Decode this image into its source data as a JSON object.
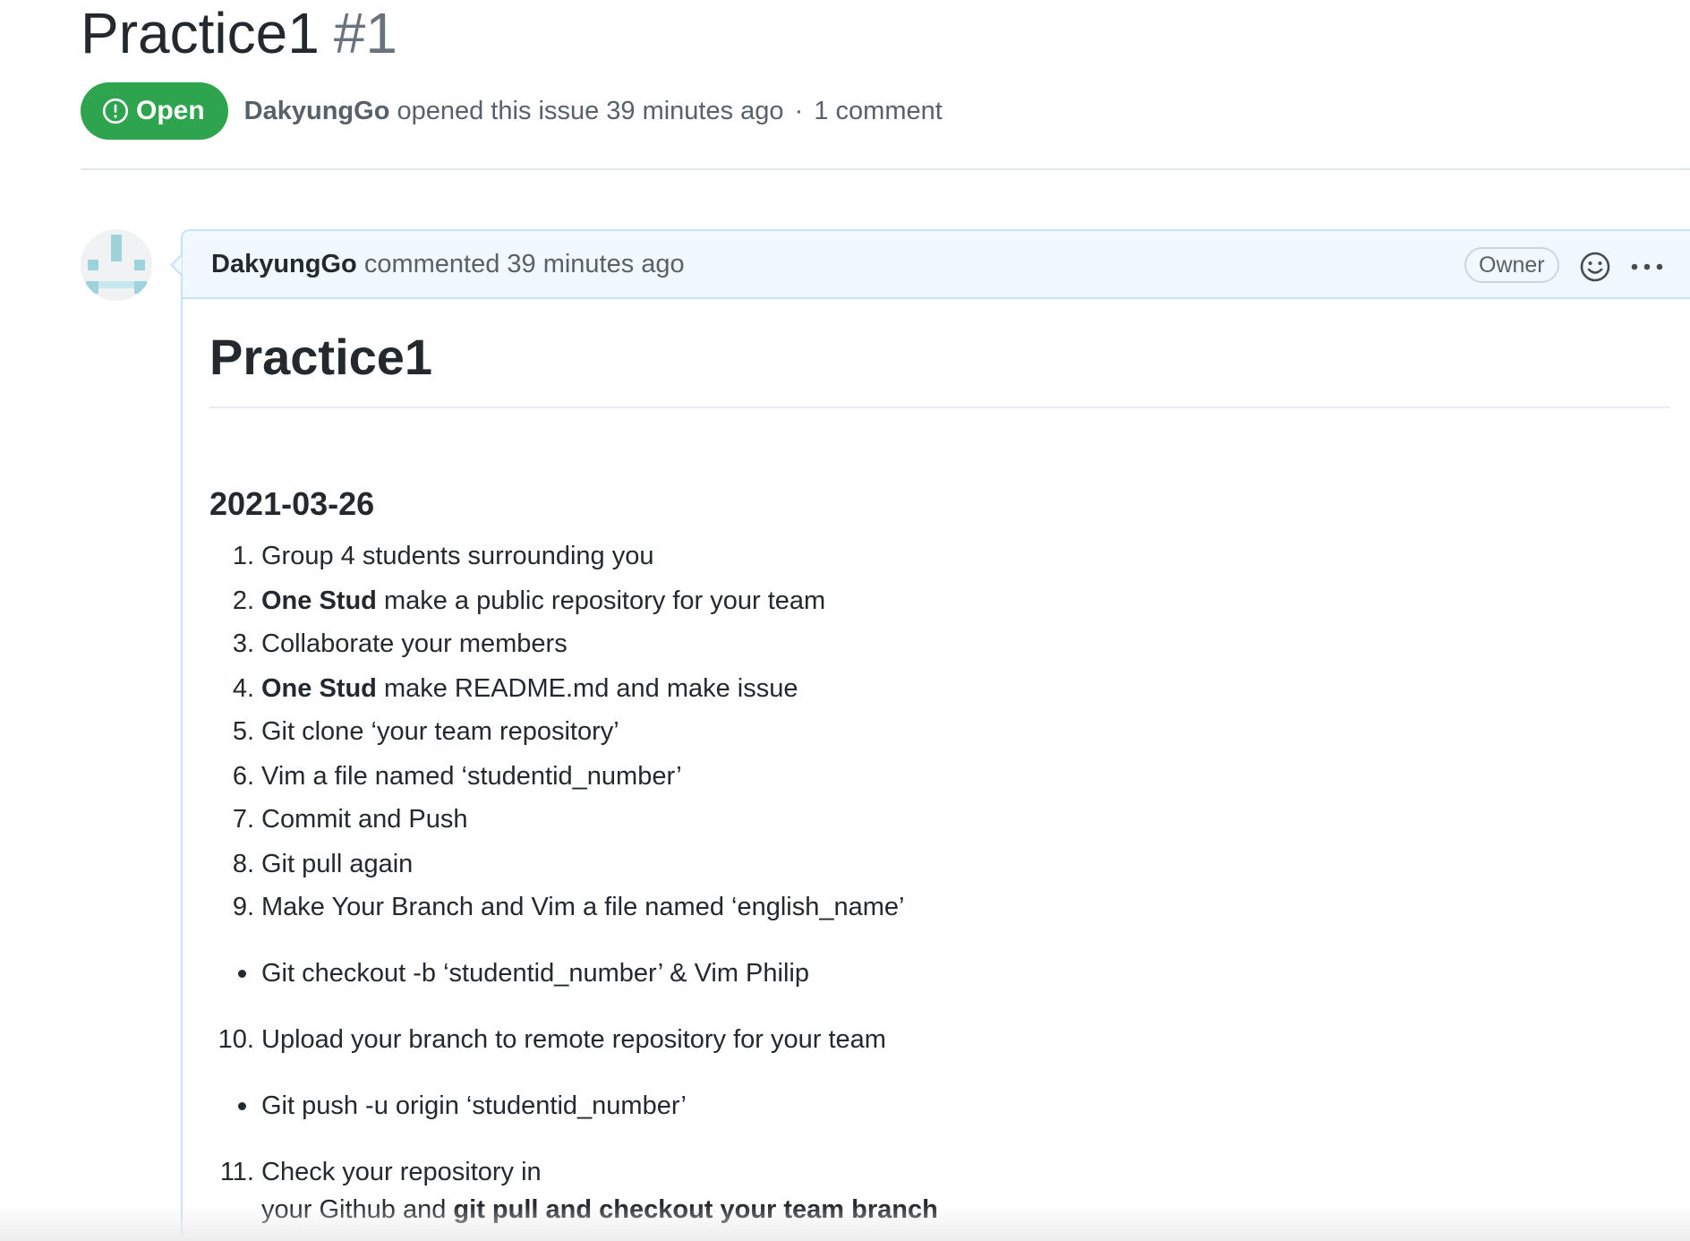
{
  "issue": {
    "title": "Practice1",
    "number": "#1",
    "state_label": "Open",
    "author": "DakyungGo",
    "opened_text": "opened this issue 39 minutes ago",
    "separator": "·",
    "comments_count": "1 comment"
  },
  "comment": {
    "author": "DakyungGo",
    "action_text": "commented 39 minutes ago",
    "role_badge": "Owner",
    "icons": {
      "reaction": "smiley-icon",
      "menu": "kebab-horizontal-icon",
      "avatar": "identicon-avatar"
    },
    "body": {
      "heading": "Practice1",
      "date": "2021-03-26",
      "items": [
        {
          "num": "1.",
          "parts": [
            {
              "text": "Group 4 students surrounding you"
            }
          ]
        },
        {
          "num": "2.",
          "parts": [
            {
              "text": "One Stud",
              "bold": true
            },
            {
              "text": " make a public repository for your team"
            }
          ]
        },
        {
          "num": "3.",
          "parts": [
            {
              "text": "Collaborate your members"
            }
          ]
        },
        {
          "num": "4.",
          "parts": [
            {
              "text": "One Stud",
              "bold": true
            },
            {
              "text": " make README.md and make issue"
            }
          ]
        },
        {
          "num": "5.",
          "parts": [
            {
              "text": "Git clone ‘your team repository’"
            }
          ]
        },
        {
          "num": "6.",
          "parts": [
            {
              "text": "Vim a file named ‘studentid_number’"
            }
          ]
        },
        {
          "num": "7.",
          "parts": [
            {
              "text": "Commit and Push"
            }
          ]
        },
        {
          "num": "8.",
          "parts": [
            {
              "text": "Git pull again"
            }
          ]
        },
        {
          "num": "9.",
          "parts": [
            {
              "text": "Make Your Branch and Vim a file named ‘english_name’"
            }
          ]
        },
        {
          "num": "",
          "bullet": true,
          "parts": [
            {
              "text": "Git checkout -b ‘studentid_number’ & Vim Philip"
            }
          ]
        },
        {
          "num": "10.",
          "parts": [
            {
              "text": "Upload your branch to remote repository for your team"
            }
          ]
        },
        {
          "num": "",
          "bullet": true,
          "parts": [
            {
              "text": "Git push -u origin ‘studentid_number’"
            }
          ]
        },
        {
          "num": "11.",
          "parts": [
            {
              "text": "Check your repository in"
            }
          ]
        },
        {
          "num": "",
          "parts": [
            {
              "text": "your Github and "
            },
            {
              "text": "git pull and checkout your team branch",
              "bold": true
            }
          ]
        }
      ]
    }
  },
  "colors": {
    "open_green": "#2ea44f",
    "comment_border": "#c8e1ff",
    "comment_header_bg": "#f1f8ff",
    "text_primary": "#24292e",
    "text_muted": "#586069"
  }
}
